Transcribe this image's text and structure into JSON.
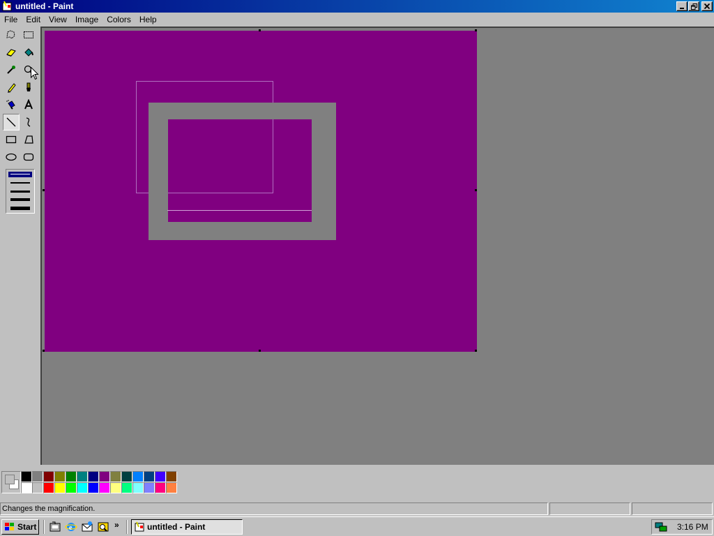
{
  "window": {
    "title": "untitled - Paint"
  },
  "menu": [
    "File",
    "Edit",
    "View",
    "Image",
    "Colors",
    "Help"
  ],
  "tools": [
    {
      "name": "free-form-select",
      "active": false
    },
    {
      "name": "rectangle-select",
      "active": false
    },
    {
      "name": "eraser",
      "active": false
    },
    {
      "name": "fill-with-color",
      "active": false
    },
    {
      "name": "pick-color",
      "active": false
    },
    {
      "name": "magnifier",
      "active": false
    },
    {
      "name": "pencil",
      "active": false
    },
    {
      "name": "brush",
      "active": false
    },
    {
      "name": "airbrush",
      "active": false
    },
    {
      "name": "text",
      "active": false
    },
    {
      "name": "line",
      "active": true
    },
    {
      "name": "curve",
      "active": false
    },
    {
      "name": "rectangle",
      "active": false
    },
    {
      "name": "polygon",
      "active": false
    },
    {
      "name": "ellipse",
      "active": false
    },
    {
      "name": "rounded-rectangle",
      "active": false
    }
  ],
  "canvas": {
    "background": "#800080",
    "shape_color": "#808080"
  },
  "palette": {
    "foreground": "#c0c0c0",
    "background": "#ffffff",
    "row1": [
      "#000000",
      "#808080",
      "#800000",
      "#808000",
      "#008000",
      "#008080",
      "#000080",
      "#800080",
      "#808040",
      "#004040",
      "#0080ff",
      "#004080",
      "#4000ff",
      "#804000"
    ],
    "row2": [
      "#ffffff",
      "#c0c0c0",
      "#ff0000",
      "#ffff00",
      "#00ff00",
      "#00ffff",
      "#0000ff",
      "#ff00ff",
      "#ffff80",
      "#00ff80",
      "#80ffff",
      "#8080ff",
      "#ff0080",
      "#ff8040"
    ]
  },
  "status": {
    "text": "Changes the magnification."
  },
  "taskbar": {
    "start_label": "Start",
    "task_label": "untitled - Paint",
    "clock": "3:16 PM",
    "chevron": "»"
  }
}
